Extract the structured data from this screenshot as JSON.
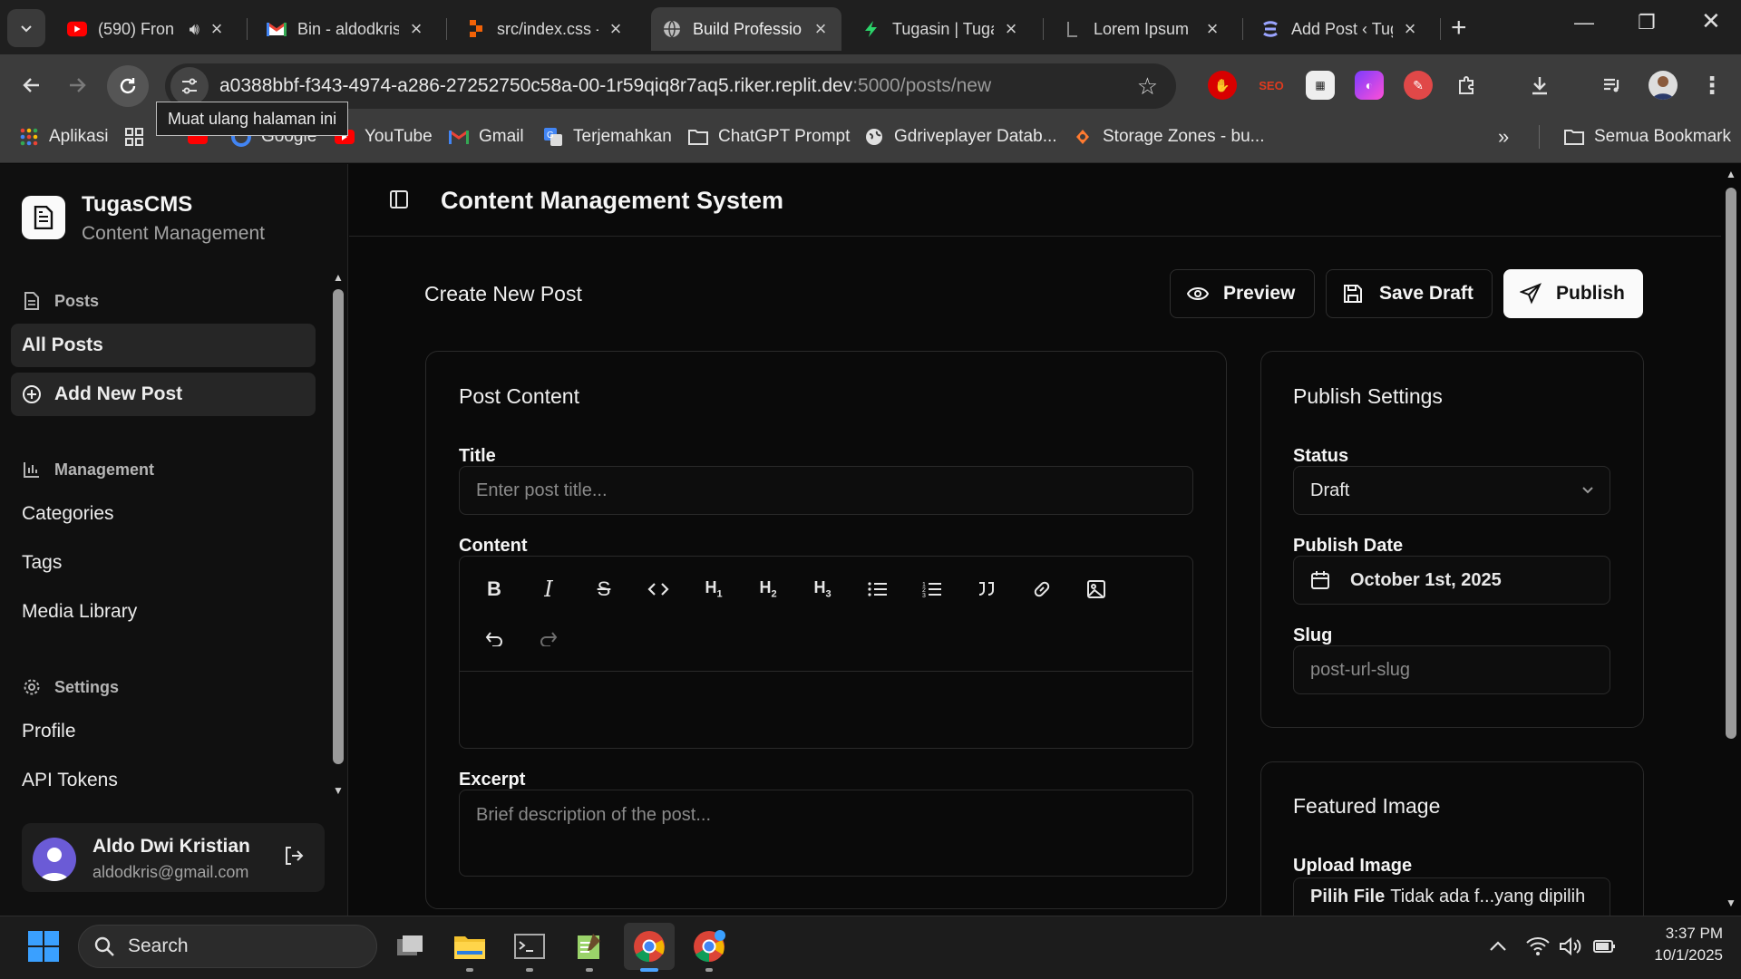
{
  "browser": {
    "tabs": [
      {
        "title": "(590) Fron",
        "favicon": "youtube-icon",
        "audio": true,
        "active": false
      },
      {
        "title": "Bin - aldodkris",
        "favicon": "gmail-icon",
        "active": false
      },
      {
        "title": "src/index.css -",
        "favicon": "replit-icon",
        "active": false
      },
      {
        "title": "Build Professio",
        "favicon": "globe-icon",
        "active": true
      },
      {
        "title": "Tugasin | Tuga",
        "favicon": "bolt-icon",
        "active": false
      },
      {
        "title": "Lorem Ipsum",
        "favicon": "lorem-icon",
        "active": false
      },
      {
        "title": "Add Post ‹ Tug",
        "favicon": "wordpress-icon",
        "active": false
      }
    ],
    "url_main": "a0388bbf-f343-4974-a286-27252750c58a-00-1r59qiq8r7aq5.riker.replit.dev",
    "url_dim": ":5000/posts/new",
    "tooltip": "Muat ulang halaman ini",
    "bookmarks": [
      {
        "label": "Aplikasi",
        "icon": "apps-grid-icon"
      },
      {
        "label": "",
        "icon": "grid-icon"
      },
      {
        "label": "Google",
        "icon": "google-icon"
      },
      {
        "label": "YouTube",
        "icon": "youtube-icon"
      },
      {
        "label": "Gmail",
        "icon": "gmail-icon"
      },
      {
        "label": "Terjemahkan",
        "icon": "translate-icon"
      },
      {
        "label": "ChatGPT Prompt",
        "icon": "folder-icon"
      },
      {
        "label": "Gdriveplayer Datab...",
        "icon": "globe-icon"
      },
      {
        "label": "Storage Zones - bu...",
        "icon": "bunny-icon"
      }
    ],
    "all_bookmarks": "Semua Bookmark"
  },
  "app": {
    "brand_name": "TugasCMS",
    "brand_sub": "Content Management",
    "header_title": "Content Management System",
    "sidebar": {
      "posts_group": "Posts",
      "all_posts": "All Posts",
      "add_new_post": "Add New Post",
      "management_group": "Management",
      "categories": "Categories",
      "tags": "Tags",
      "media_library": "Media Library",
      "settings_group": "Settings",
      "profile": "Profile",
      "api_tokens": "API Tokens"
    },
    "user": {
      "name": "Aldo Dwi Kristian",
      "email": "aldodkris@gmail.com"
    },
    "page_title": "Create New Post",
    "actions": {
      "preview": "Preview",
      "save_draft": "Save Draft",
      "publish": "Publish"
    },
    "post_content": {
      "title": "Post Content",
      "title_label": "Title",
      "title_placeholder": "Enter post title...",
      "content_label": "Content",
      "excerpt_label": "Excerpt",
      "excerpt_placeholder": "Brief description of the post..."
    },
    "toolbar_buttons": [
      "bold",
      "italic",
      "strikethrough",
      "code",
      "H1",
      "H2",
      "H3",
      "bullet-list",
      "ordered-list",
      "quote",
      "link",
      "image",
      "undo",
      "redo"
    ],
    "publish_settings": {
      "title": "Publish Settings",
      "status_label": "Status",
      "status_value": "Draft",
      "date_label": "Publish Date",
      "date_value": "October 1st, 2025",
      "slug_label": "Slug",
      "slug_placeholder": "post-url-slug"
    },
    "featured_image": {
      "title": "Featured Image",
      "upload_label": "Upload Image",
      "file_button": "Pilih File",
      "file_status": "Tidak ada f...yang dipilih"
    }
  },
  "taskbar": {
    "search_placeholder": "Search",
    "time": "3:37 PM",
    "date": "10/1/2025"
  }
}
